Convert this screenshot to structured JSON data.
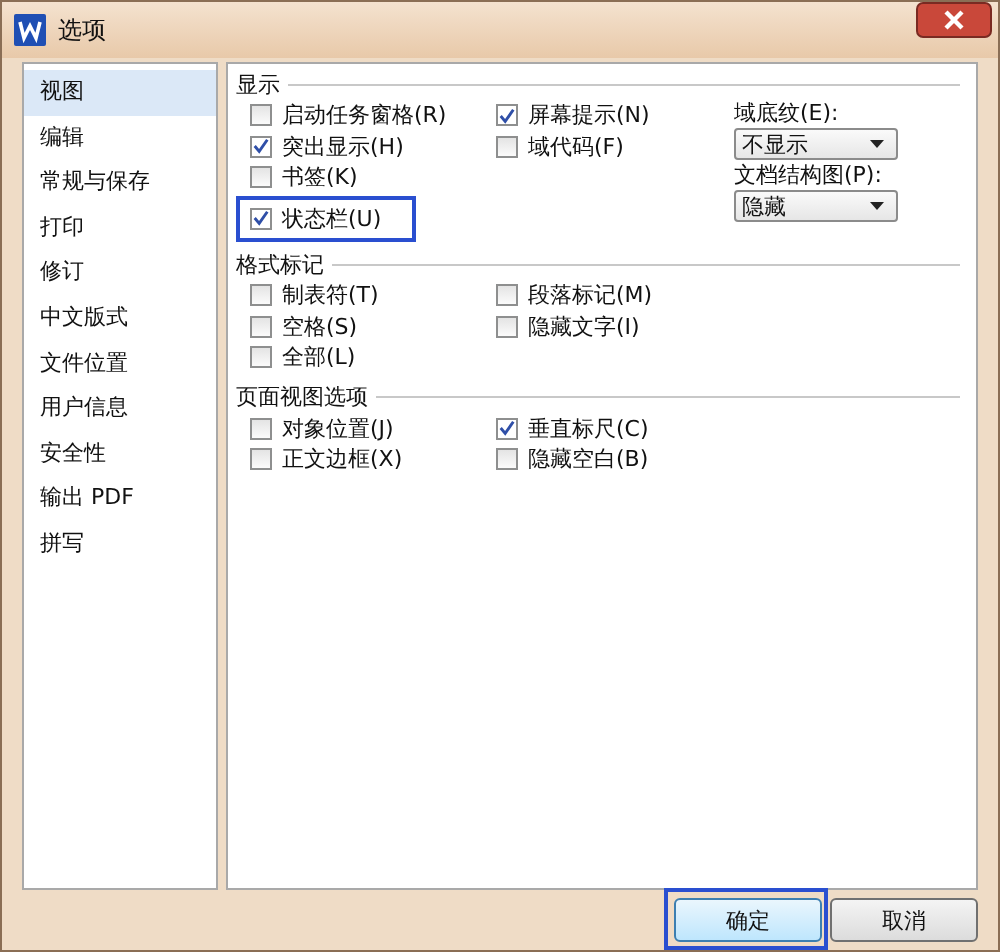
{
  "window": {
    "title": "选项"
  },
  "sidebar": {
    "items": [
      {
        "label": "视图",
        "selected": true
      },
      {
        "label": "编辑",
        "selected": false
      },
      {
        "label": "常规与保存",
        "selected": false
      },
      {
        "label": "打印",
        "selected": false
      },
      {
        "label": "修订",
        "selected": false
      },
      {
        "label": "中文版式",
        "selected": false
      },
      {
        "label": "文件位置",
        "selected": false
      },
      {
        "label": "用户信息",
        "selected": false
      },
      {
        "label": "安全性",
        "selected": false
      },
      {
        "label": "输出 PDF",
        "selected": false
      },
      {
        "label": "拼写",
        "selected": false
      }
    ]
  },
  "sections": [
    {
      "title": "显示",
      "left": [
        {
          "label": "启动任务窗格(R)",
          "checked": false,
          "highlighted": false
        },
        {
          "label": "突出显示(H)",
          "checked": true,
          "highlighted": false
        },
        {
          "label": "书签(K)",
          "checked": false,
          "highlighted": false
        },
        {
          "label": "状态栏(U)",
          "checked": true,
          "highlighted": true
        }
      ],
      "right": [
        {
          "label": "屏幕提示(N)",
          "checked": true,
          "highlighted": false
        },
        {
          "label": "域代码(F)",
          "checked": false,
          "highlighted": false
        }
      ],
      "fields": [
        {
          "label": "域底纹(E):",
          "value": "不显示"
        },
        {
          "label": "文档结构图(P):",
          "value": "隐藏"
        }
      ]
    },
    {
      "title": "格式标记",
      "left": [
        {
          "label": "制表符(T)",
          "checked": false,
          "highlighted": false
        },
        {
          "label": "空格(S)",
          "checked": false,
          "highlighted": false
        },
        {
          "label": "全部(L)",
          "checked": false,
          "highlighted": false
        }
      ],
      "right": [
        {
          "label": "段落标记(M)",
          "checked": false,
          "highlighted": false
        },
        {
          "label": "隐藏文字(I)",
          "checked": false,
          "highlighted": false
        }
      ]
    },
    {
      "title": "页面视图选项",
      "left": [
        {
          "label": "对象位置(J)",
          "checked": false,
          "highlighted": false
        },
        {
          "label": "正文边框(X)",
          "checked": false,
          "highlighted": false
        }
      ],
      "right": [
        {
          "label": "垂直标尺(C)",
          "checked": true,
          "highlighted": false
        },
        {
          "label": "隐藏空白(B)",
          "checked": false,
          "highlighted": false
        }
      ]
    }
  ],
  "buttons": [
    {
      "label": "确定",
      "highlighted": true
    },
    {
      "label": "取消",
      "highlighted": false
    }
  ]
}
